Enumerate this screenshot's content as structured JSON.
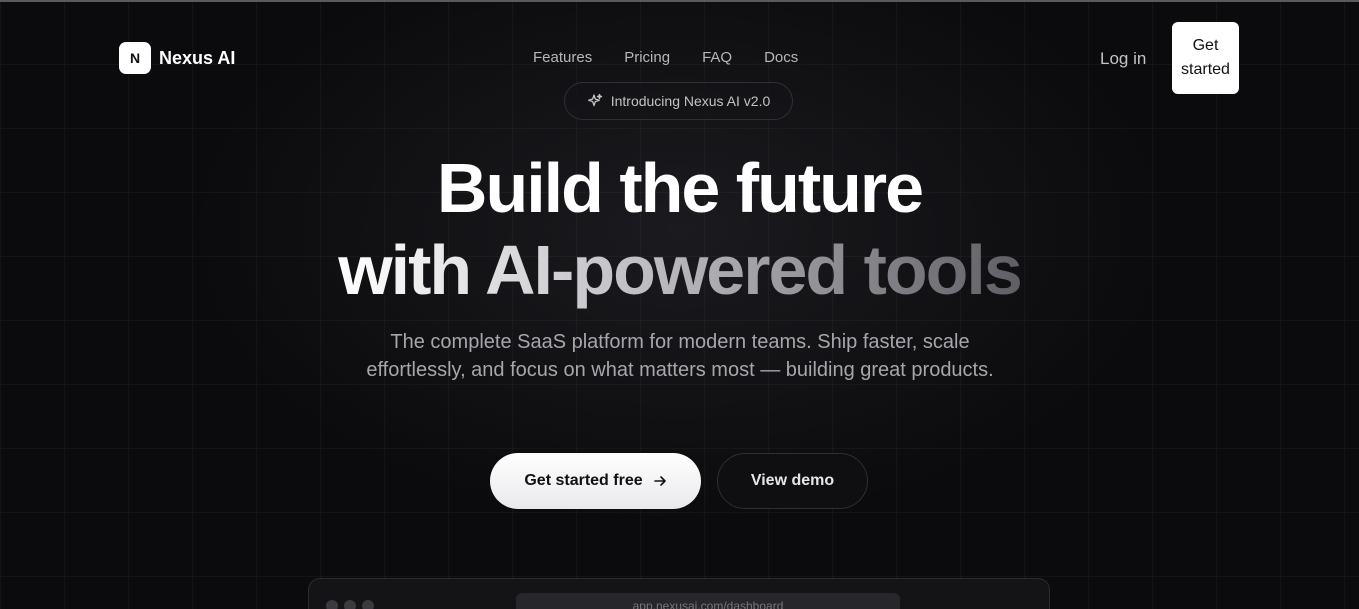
{
  "header": {
    "logo_letter": "N",
    "brand": "Nexus AI",
    "nav": [
      "Features",
      "Pricing",
      "FAQ",
      "Docs"
    ],
    "login": "Log in",
    "cta": "Get started"
  },
  "badge": {
    "icon": "sparkles-icon",
    "text": "Introducing Nexus AI v2.0"
  },
  "hero": {
    "line1": "Build the future",
    "line2": "with AI-powered tools",
    "subtitle": "The complete SaaS platform for modern teams. Ship faster, scale effortlessly, and focus on what matters most — building great products."
  },
  "actions": {
    "primary": "Get started free",
    "primary_icon": "arrow-right-icon",
    "secondary": "View demo"
  },
  "preview": {
    "url": "app.nexusai.com/dashboard"
  },
  "colors": {
    "background": "#0b0b0d",
    "primary_button": "#ffffff",
    "text_muted": "#a6a6ac"
  }
}
